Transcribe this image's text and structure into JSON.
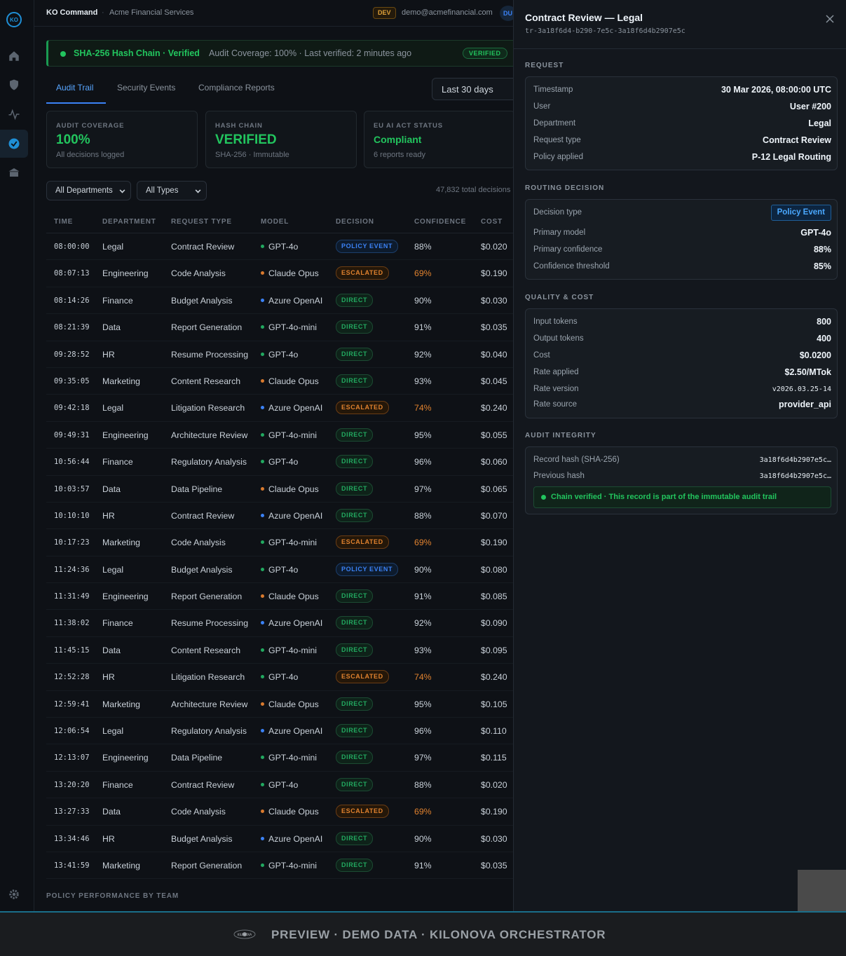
{
  "sidebar": {
    "logo": "KO",
    "items": [
      {
        "name": "home-icon"
      },
      {
        "name": "shield-icon"
      },
      {
        "name": "activity-icon"
      },
      {
        "name": "check-circle-icon",
        "active": true
      },
      {
        "name": "building-icon"
      }
    ],
    "settings_icon": "gear-icon"
  },
  "topbar": {
    "app_name": "KO Command",
    "separator": "·",
    "org": "Acme Financial Services",
    "env": "DEV",
    "email": "demo@acmefinancial.com",
    "user_initials": "DU"
  },
  "banner": {
    "title": "SHA-256 Hash Chain · Verified",
    "detail": "Audit Coverage: 100% · Last verified: 2 minutes ago",
    "badge": "VERIFIED"
  },
  "tabs": [
    {
      "label": "Audit Trail",
      "active": true
    },
    {
      "label": "Security Events"
    },
    {
      "label": "Compliance Reports"
    }
  ],
  "range": "Last 30 days",
  "cards": [
    {
      "label": "AUDIT COVERAGE",
      "value": "100%",
      "sub": "All decisions logged"
    },
    {
      "label": "HASH CHAIN",
      "value": "VERIFIED",
      "sub": "SHA-256 · Immutable"
    },
    {
      "label": "EU AI ACT STATUS",
      "value": "Compliant",
      "sub": "6 reports ready"
    }
  ],
  "filters": {
    "department": "All Departments",
    "type": "All Types",
    "total": "47,832 total decisions"
  },
  "table": {
    "headers": [
      "TIME",
      "DEPARTMENT",
      "REQUEST TYPE",
      "MODEL",
      "DECISION",
      "CONFIDENCE",
      "COST"
    ],
    "rows": [
      [
        "08:00:00",
        "Legal",
        "Contract Review",
        "GPT-4o",
        "POLICY EVENT",
        "88%",
        "$0.020"
      ],
      [
        "08:07:13",
        "Engineering",
        "Code Analysis",
        "Claude Opus",
        "ESCALATED",
        "69%",
        "$0.190"
      ],
      [
        "08:14:26",
        "Finance",
        "Budget Analysis",
        "Azure OpenAI",
        "DIRECT",
        "90%",
        "$0.030"
      ],
      [
        "08:21:39",
        "Data",
        "Report Generation",
        "GPT-4o-mini",
        "DIRECT",
        "91%",
        "$0.035"
      ],
      [
        "09:28:52",
        "HR",
        "Resume Processing",
        "GPT-4o",
        "DIRECT",
        "92%",
        "$0.040"
      ],
      [
        "09:35:05",
        "Marketing",
        "Content Research",
        "Claude Opus",
        "DIRECT",
        "93%",
        "$0.045"
      ],
      [
        "09:42:18",
        "Legal",
        "Litigation Research",
        "Azure OpenAI",
        "ESCALATED",
        "74%",
        "$0.240"
      ],
      [
        "09:49:31",
        "Engineering",
        "Architecture Review",
        "GPT-4o-mini",
        "DIRECT",
        "95%",
        "$0.055"
      ],
      [
        "10:56:44",
        "Finance",
        "Regulatory Analysis",
        "GPT-4o",
        "DIRECT",
        "96%",
        "$0.060"
      ],
      [
        "10:03:57",
        "Data",
        "Data Pipeline",
        "Claude Opus",
        "DIRECT",
        "97%",
        "$0.065"
      ],
      [
        "10:10:10",
        "HR",
        "Contract Review",
        "Azure OpenAI",
        "DIRECT",
        "88%",
        "$0.070"
      ],
      [
        "10:17:23",
        "Marketing",
        "Code Analysis",
        "GPT-4o-mini",
        "ESCALATED",
        "69%",
        "$0.190"
      ],
      [
        "11:24:36",
        "Legal",
        "Budget Analysis",
        "GPT-4o",
        "POLICY EVENT",
        "90%",
        "$0.080"
      ],
      [
        "11:31:49",
        "Engineering",
        "Report Generation",
        "Claude Opus",
        "DIRECT",
        "91%",
        "$0.085"
      ],
      [
        "11:38:02",
        "Finance",
        "Resume Processing",
        "Azure OpenAI",
        "DIRECT",
        "92%",
        "$0.090"
      ],
      [
        "11:45:15",
        "Data",
        "Content Research",
        "GPT-4o-mini",
        "DIRECT",
        "93%",
        "$0.095"
      ],
      [
        "12:52:28",
        "HR",
        "Litigation Research",
        "GPT-4o",
        "ESCALATED",
        "74%",
        "$0.240"
      ],
      [
        "12:59:41",
        "Marketing",
        "Architecture Review",
        "Claude Opus",
        "DIRECT",
        "95%",
        "$0.105"
      ],
      [
        "12:06:54",
        "Legal",
        "Regulatory Analysis",
        "Azure OpenAI",
        "DIRECT",
        "96%",
        "$0.110"
      ],
      [
        "12:13:07",
        "Engineering",
        "Data Pipeline",
        "GPT-4o-mini",
        "DIRECT",
        "97%",
        "$0.115"
      ],
      [
        "13:20:20",
        "Finance",
        "Contract Review",
        "GPT-4o",
        "DIRECT",
        "88%",
        "$0.020"
      ],
      [
        "13:27:33",
        "Data",
        "Code Analysis",
        "Claude Opus",
        "ESCALATED",
        "69%",
        "$0.190"
      ],
      [
        "13:34:46",
        "HR",
        "Budget Analysis",
        "Azure OpenAI",
        "DIRECT",
        "90%",
        "$0.030"
      ],
      [
        "13:41:59",
        "Marketing",
        "Report Generation",
        "GPT-4o-mini",
        "DIRECT",
        "91%",
        "$0.035"
      ]
    ]
  },
  "model_colors": {
    "GPT-4o": "#22a960",
    "GPT-4o-mini": "#22a960",
    "Claude Opus": "#d97a2e",
    "Azure OpenAI": "#3b82f6"
  },
  "section_footer": "POLICY PERFORMANCE BY TEAM",
  "panel": {
    "title": "Contract Review — Legal",
    "trace_id": "tr-3a18f6d4-b290-7e5c-3a18f6d4b2907e5c",
    "request": {
      "heading": "REQUEST",
      "items": [
        {
          "k": "Timestamp",
          "v": "30 Mar 2026, 08:00:00 UTC"
        },
        {
          "k": "User",
          "v": "User #200"
        },
        {
          "k": "Department",
          "v": "Legal"
        },
        {
          "k": "Request type",
          "v": "Contract Review"
        },
        {
          "k": "Policy applied",
          "v": "P-12 Legal Routing"
        }
      ]
    },
    "routing": {
      "heading": "ROUTING DECISION",
      "decision_type_label": "Decision type",
      "decision_type": "Policy Event",
      "items": [
        {
          "k": "Primary model",
          "v": "GPT-4o"
        },
        {
          "k": "Primary confidence",
          "v": "88%"
        },
        {
          "k": "Confidence threshold",
          "v": "85%"
        }
      ]
    },
    "quality": {
      "heading": "QUALITY & COST",
      "items": [
        {
          "k": "Input tokens",
          "v": "800"
        },
        {
          "k": "Output tokens",
          "v": "400"
        },
        {
          "k": "Cost",
          "v": "$0.0200"
        },
        {
          "k": "Rate applied",
          "v": "$2.50/MTok"
        },
        {
          "k": "Rate version",
          "v": "v2026.03.25-14"
        },
        {
          "k": "Rate source",
          "v": "provider_api"
        }
      ]
    },
    "integrity": {
      "heading": "AUDIT INTEGRITY",
      "record_label": "Record hash (SHA-256)",
      "record_hash": "3a18f6d4b2907e5c…",
      "previous_label": "Previous hash",
      "previous_hash": "3a18f6d4b2907e5c…",
      "chain_text": "Chain verified · This record is part of the immutable audit trail"
    }
  },
  "preview": {
    "logo_text": "KILONOVA",
    "text": "PREVIEW · DEMO DATA · KILONOVA ORCHESTRATOR"
  }
}
